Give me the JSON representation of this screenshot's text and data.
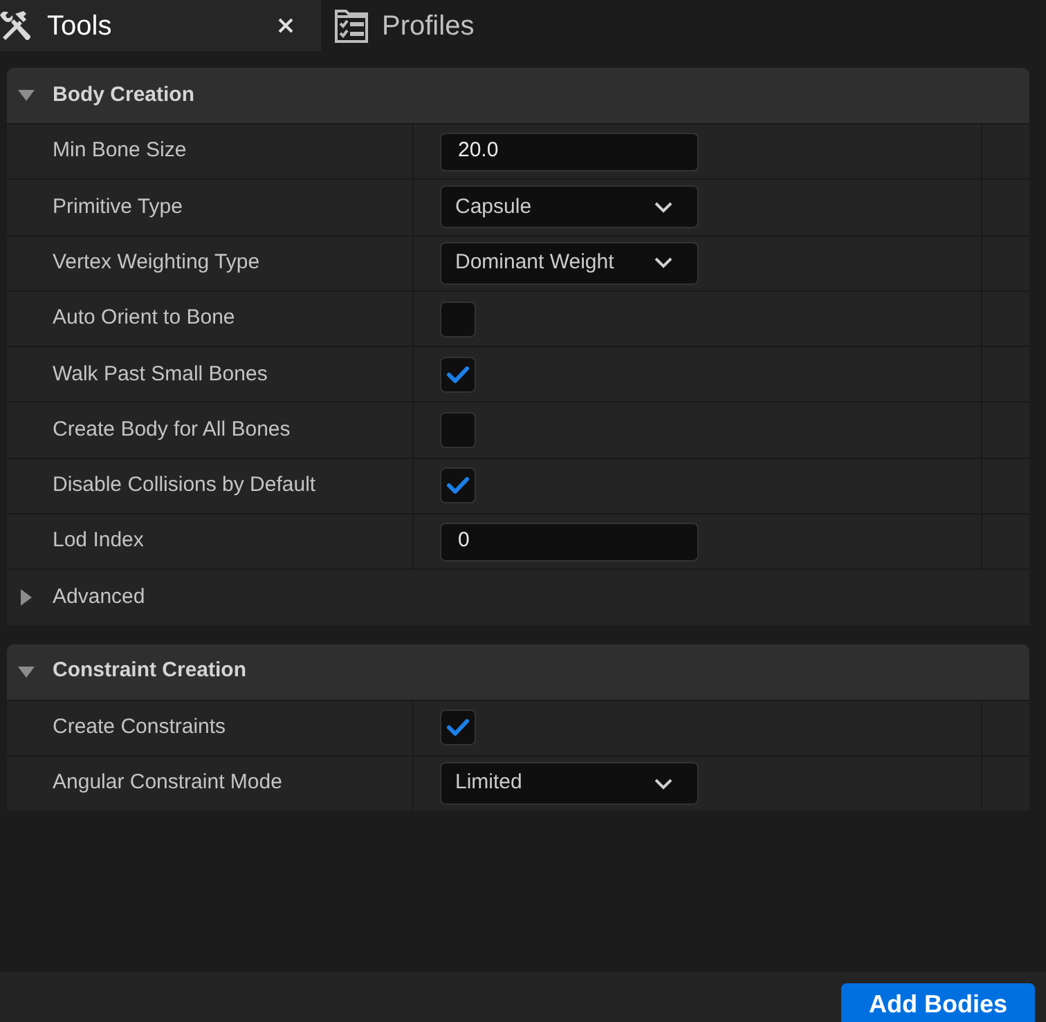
{
  "tabs": [
    {
      "label": "Tools",
      "selected": true
    },
    {
      "label": "Profiles",
      "selected": false
    }
  ],
  "sections": [
    {
      "title": "Body Creation",
      "expanded": true,
      "rows": [
        {
          "kind": "number",
          "label": "Min Bone Size",
          "value": "20.0"
        },
        {
          "kind": "dropdown",
          "label": "Primitive Type",
          "value": "Capsule"
        },
        {
          "kind": "dropdown",
          "label": "Vertex Weighting Type",
          "value": "Dominant Weight"
        },
        {
          "kind": "checkbox",
          "label": "Auto Orient to Bone",
          "checked": false
        },
        {
          "kind": "checkbox",
          "label": "Walk Past Small Bones",
          "checked": true
        },
        {
          "kind": "checkbox",
          "label": "Create Body for All Bones",
          "checked": false
        },
        {
          "kind": "checkbox",
          "label": "Disable Collisions by Default",
          "checked": true
        },
        {
          "kind": "number",
          "label": "Lod Index",
          "value": "0"
        },
        {
          "kind": "group",
          "label": "Advanced",
          "expanded": false
        }
      ]
    },
    {
      "title": "Constraint Creation",
      "expanded": true,
      "rows": [
        {
          "kind": "checkbox",
          "label": "Create Constraints",
          "checked": true
        },
        {
          "kind": "dropdown",
          "label": "Angular Constraint Mode",
          "value": "Limited"
        }
      ]
    }
  ],
  "add_button": {
    "label": "Add Bodies"
  }
}
